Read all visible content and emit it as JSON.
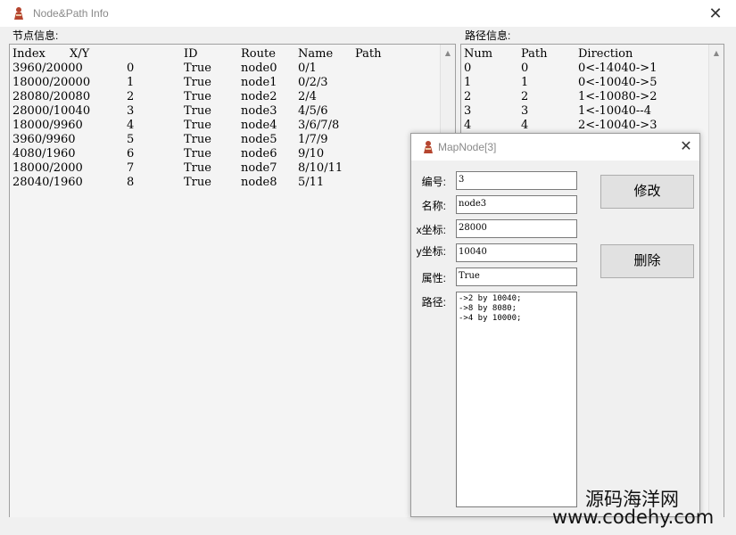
{
  "main_window": {
    "title": "Node&Path Info",
    "close_symbol": "✕"
  },
  "node_panel": {
    "label": "节点信息:",
    "headers": [
      "Index",
      "X/Y",
      "ID",
      "Route",
      "Name",
      "Path"
    ],
    "rows": [
      [
        "3960/20000",
        "0",
        "True",
        "node0",
        "0/1"
      ],
      [
        "18000/20000",
        "1",
        "True",
        "node1",
        "0/2/3"
      ],
      [
        "28080/20080",
        "2",
        "True",
        "node2",
        "2/4"
      ],
      [
        "28000/10040",
        "3",
        "True",
        "node3",
        "4/5/6"
      ],
      [
        "18000/9960",
        "4",
        "True",
        "node4",
        "3/6/7/8"
      ],
      [
        "3960/9960",
        "5",
        "True",
        "node5",
        "1/7/9"
      ],
      [
        "4080/1960",
        "6",
        "True",
        "node6",
        "9/10"
      ],
      [
        "18000/2000",
        "7",
        "True",
        "node7",
        "8/10/11"
      ],
      [
        "28040/1960",
        "8",
        "True",
        "node8",
        "5/11"
      ]
    ]
  },
  "path_panel": {
    "label": "路径信息:",
    "headers": [
      "Num",
      "Path",
      "Direction"
    ],
    "rows": [
      [
        "0",
        "0",
        "0<-14040->1"
      ],
      [
        "1",
        "1",
        "0<-10040->5"
      ],
      [
        "2",
        "2",
        "1<-10080->2"
      ],
      [
        "3",
        "3",
        "1<-10040--4"
      ],
      [
        "4",
        "4",
        "2<-10040->3"
      ]
    ]
  },
  "dialog": {
    "title": "MapNode[3]",
    "close_symbol": "✕",
    "fields": [
      {
        "label": "编号:",
        "value": "3"
      },
      {
        "label": "名称:",
        "value": "node3"
      },
      {
        "label": "x坐标:",
        "value": "28000"
      },
      {
        "label": "y坐标:",
        "value": "10040"
      },
      {
        "label": "属性:",
        "value": "True"
      }
    ],
    "path_label": "路径:",
    "path_lines": [
      "->2 by 10040;",
      "->8 by 8080;",
      "->4 by 10000;"
    ],
    "modify_button": "修改",
    "delete_button": "删除"
  },
  "watermark": {
    "line1": "源码海洋网",
    "line2": "www.codehy.com"
  },
  "icons": {
    "app_icon": "app-logo-icon",
    "scroll_up": "scroll-up-icon",
    "scroll_down": "scroll-down-icon"
  },
  "colors": {
    "app_icon_red": "#b5452f",
    "window_bg": "#f0f0f0",
    "title_text": "#8a8a8a"
  }
}
